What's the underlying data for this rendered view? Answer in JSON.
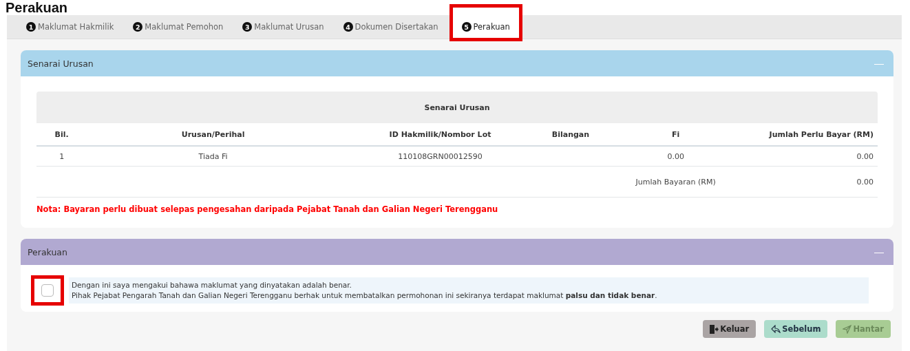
{
  "page_title": "Perakuan",
  "tabs": [
    {
      "number": "1",
      "label": "Maklumat Hakmilik",
      "selected": false
    },
    {
      "number": "2",
      "label": "Maklumat Pemohon",
      "selected": false
    },
    {
      "number": "3",
      "label": "Maklumat Urusan",
      "selected": false
    },
    {
      "number": "4",
      "label": "Dokumen Disertakan",
      "selected": false
    },
    {
      "number": "5",
      "label": "Perakuan",
      "selected": true
    }
  ],
  "urusan_panel": {
    "title": "Senarai Urusan",
    "collapse": "—",
    "table": {
      "caption": "Senarai Urusan",
      "columns": [
        "Bil.",
        "Urusan/Perihal",
        "ID Hakmilik/Nombor Lot",
        "Bilangan",
        "Fi",
        "Jumlah Perlu Bayar (RM)"
      ],
      "rows": [
        [
          "1",
          "Tiada Fi",
          "110108GRN00012590",
          "",
          "0.00",
          "0.00"
        ]
      ],
      "total_label": "Jumlah Bayaran (RM)",
      "total_value": "0.00"
    },
    "note": "Nota: Bayaran perlu dibuat selepas pengesahan daripada Pejabat Tanah dan Galian Negeri Terengganu"
  },
  "perakuan_panel": {
    "title": "Perakuan",
    "collapse": "—",
    "checked": false,
    "lines": [
      "Dengan ini saya mengakui bahawa maklumat yang dinyatakan adalah benar.",
      "Pihak Pejabat Pengarah Tanah dan Galian Negeri Terengganu berhak untuk membatalkan permohonan ini sekiranya terdapat maklumat **palsu dan tidak benar**."
    ]
  },
  "buttons": [
    {
      "kind": "exit",
      "label": "Keluar"
    },
    {
      "kind": "back",
      "label": "Sebelum"
    },
    {
      "kind": "send",
      "label": "Hantar"
    }
  ]
}
